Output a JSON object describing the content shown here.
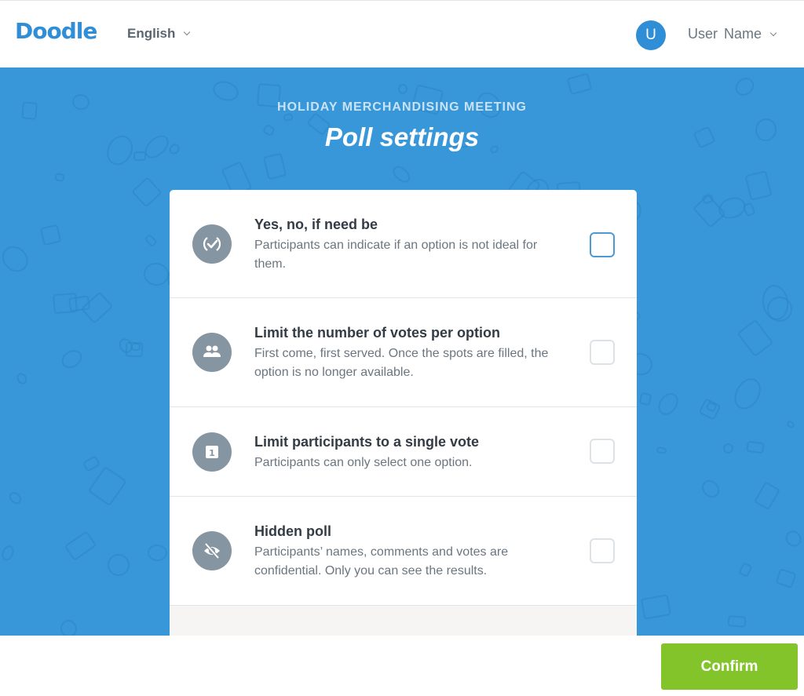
{
  "header": {
    "logo": "Doodle",
    "language": "English",
    "avatar_initial": "U",
    "user_name": "User Name"
  },
  "hero": {
    "subtitle": "HOLIDAY MERCHANDISING MEETING",
    "title": "Poll settings"
  },
  "settings": [
    {
      "icon": "check-circle-icon",
      "title": "Yes, no, if need be",
      "description": "Participants can indicate if an option is not ideal for them.",
      "checked": false
    },
    {
      "icon": "people-icon",
      "title": "Limit the number of votes per option",
      "description": "First come, first served. Once the spots are filled, the option is no longer available.",
      "checked": false
    },
    {
      "icon": "number-one-icon",
      "title": "Limit participants to a single vote",
      "description": "Participants can only select one option.",
      "checked": false
    },
    {
      "icon": "eye-off-icon",
      "title": "Hidden poll",
      "description": "Participants’ names, comments and votes are confidential. Only you can see the results.",
      "checked": false
    }
  ],
  "footer": {
    "confirm_label": "Confirm"
  },
  "colors": {
    "brand_blue": "#3797d8",
    "confirm_green": "#84c42b",
    "icon_gray": "#8595a1"
  }
}
